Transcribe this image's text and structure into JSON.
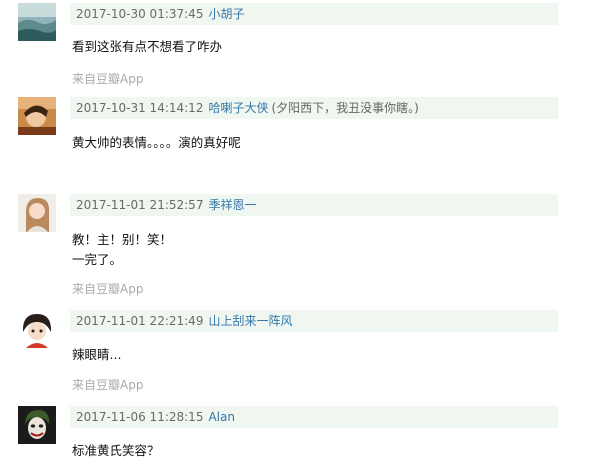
{
  "comments": [
    {
      "time": "2017-10-30 01:37:45",
      "author": "小胡子",
      "signature": "",
      "lines": [
        "看到这张有点不想看了咋办"
      ],
      "source": "来自豆瓣App",
      "avatar_icon": "landscape-avatar-icon"
    },
    {
      "time": "2017-10-31 14:14:12",
      "author": "哈喇子大侠",
      "signature": "(夕阳西下，我丑没事你瞎。)",
      "lines": [
        "黄大帅的表情。。。。演的真好呢"
      ],
      "source": "",
      "avatar_icon": "person-avatar-icon"
    },
    {
      "time": "2017-11-01 21:52:57",
      "author": "季祥恩一",
      "signature": "",
      "lines": [
        "教！主！别！笑！",
        "一完了。"
      ],
      "source": "来自豆瓣App",
      "avatar_icon": "girl-avatar-icon"
    },
    {
      "time": "2017-11-01 22:21:49",
      "author": "山上刮来一阵风",
      "signature": "",
      "lines": [
        "辣眼睛..."
      ],
      "source": "来自豆瓣App",
      "avatar_icon": "cartoon-avatar-icon"
    },
    {
      "time": "2017-11-06 11:28:15",
      "author": "Alan",
      "signature": "",
      "lines": [
        "标准黄氏笑容？"
      ],
      "source": "",
      "avatar_icon": "joker-avatar-icon"
    }
  ]
}
